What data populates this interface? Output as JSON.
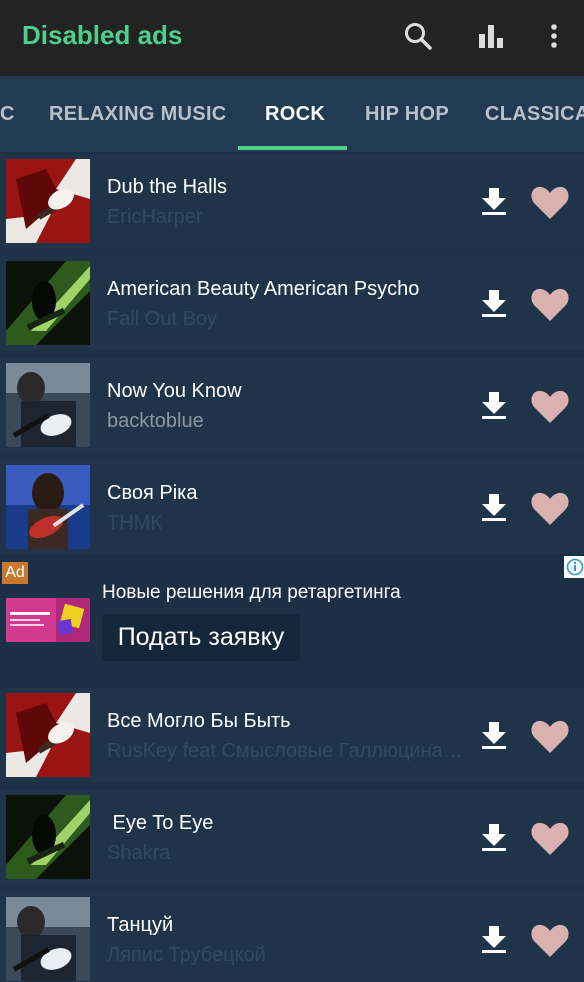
{
  "app_bar": {
    "title": "Disabled ads",
    "icons": [
      "search-icon",
      "equalizer-icon",
      "more-vert-icon"
    ]
  },
  "tabs": [
    {
      "label": "C",
      "active": false
    },
    {
      "label": "RELAXING MUSIC",
      "active": false
    },
    {
      "label": "ROCK",
      "active": true
    },
    {
      "label": "HIP HOP",
      "active": false
    },
    {
      "label": "CLASSICA",
      "active": false
    }
  ],
  "songs": [
    {
      "title": "Dub the Halls",
      "artist": "EricHarper"
    },
    {
      "title": "American Beauty American Psycho",
      "artist": "Fall Out Boy"
    },
    {
      "title": "Now You Know",
      "artist": "backtoblue"
    },
    {
      "title": "Своя Ріка",
      "artist": "ТНМК"
    },
    {
      "title": "Все Могло Бы Быть",
      "artist": "RusKey feat Смысловые Галлюцинации"
    },
    {
      "title": " Eye To Eye",
      "artist": "Shakra"
    },
    {
      "title": "Танцуй",
      "artist": "Ляпис Трубецкой"
    }
  ],
  "ad": {
    "badge": "Ad",
    "text": "Новые решения для ретаргетинга",
    "button": "Подать заявку"
  },
  "colors": {
    "accent": "#4fd08a",
    "heart": "#d9b2b0",
    "background": "#1c3046"
  }
}
